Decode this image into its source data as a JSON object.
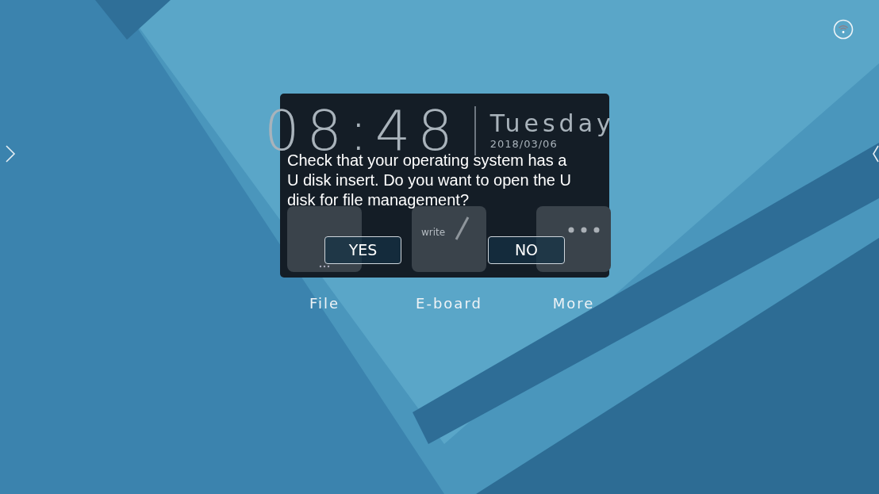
{
  "clock": {
    "time": "08:48",
    "day": "Tuesday",
    "date": "2018/03/06"
  },
  "apps": [
    {
      "label": "File",
      "kind": "file"
    },
    {
      "label": "E-board",
      "kind": "eboard",
      "caption": "write"
    },
    {
      "label": "More",
      "kind": "more"
    }
  ],
  "dialog": {
    "message": "Check that your operating system has a U disk insert. Do you want to open the U disk for file management?",
    "buttons": [
      {
        "label": "YES"
      },
      {
        "label": "NO"
      }
    ]
  }
}
